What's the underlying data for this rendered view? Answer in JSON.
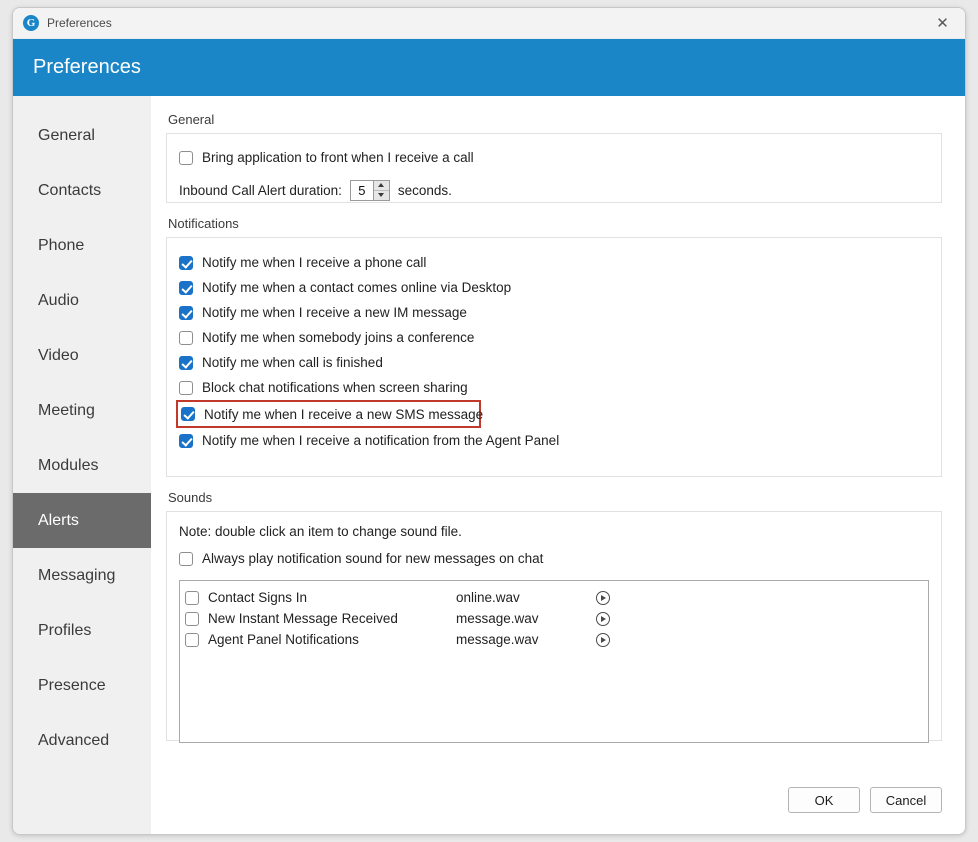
{
  "titlebar": {
    "app_icon": "app-logo-g",
    "title": "Preferences",
    "close_icon": "✕"
  },
  "header": {
    "title": "Preferences",
    "accent_color": "#1a86c8"
  },
  "sidebar": {
    "selected": "Alerts",
    "selected_bg": "#6b6b6b",
    "items": [
      {
        "label": "General"
      },
      {
        "label": "Contacts"
      },
      {
        "label": "Phone"
      },
      {
        "label": "Audio"
      },
      {
        "label": "Video"
      },
      {
        "label": "Meeting"
      },
      {
        "label": "Modules"
      },
      {
        "label": "Alerts"
      },
      {
        "label": "Messaging"
      },
      {
        "label": "Profiles"
      },
      {
        "label": "Presence"
      },
      {
        "label": "Advanced"
      }
    ]
  },
  "general_section": {
    "label": "General",
    "bring_to_front": {
      "label": "Bring application to front when I receive a call",
      "checked": false
    },
    "duration": {
      "prefix": "Inbound Call Alert duration:",
      "value": "5",
      "suffix": "seconds."
    }
  },
  "notifications_section": {
    "label": "Notifications",
    "highlight_color": "#c0392b",
    "items": [
      {
        "label": "Notify me when I receive a phone call",
        "checked": true,
        "highlighted": false
      },
      {
        "label": "Notify me when a contact comes online via Desktop",
        "checked": true,
        "highlighted": false
      },
      {
        "label": "Notify me when I receive a new IM message",
        "checked": true,
        "highlighted": false
      },
      {
        "label": "Notify me when somebody joins a conference",
        "checked": false,
        "highlighted": false
      },
      {
        "label": "Notify me when call is finished",
        "checked": true,
        "highlighted": false
      },
      {
        "label": "Block chat notifications when screen sharing",
        "checked": false,
        "highlighted": false
      },
      {
        "label": "Notify me when I receive a new SMS message",
        "checked": true,
        "highlighted": true
      },
      {
        "label": "Notify me when I receive a notification from the Agent Panel",
        "checked": true,
        "highlighted": false
      }
    ]
  },
  "sounds_section": {
    "label": "Sounds",
    "note": "Note: double click an item to change sound file.",
    "always_play": {
      "label": "Always play notification sound for new messages on chat",
      "checked": false
    },
    "list": [
      {
        "name": "Contact Signs In",
        "file": "online.wav",
        "checked": false,
        "play_icon": "play-icon"
      },
      {
        "name": "New Instant Message Received",
        "file": "message.wav",
        "checked": false,
        "play_icon": "play-icon"
      },
      {
        "name": "Agent Panel Notifications",
        "file": "message.wav",
        "checked": false,
        "play_icon": "play-icon"
      }
    ]
  },
  "footer": {
    "ok_label": "OK",
    "cancel_label": "Cancel"
  }
}
